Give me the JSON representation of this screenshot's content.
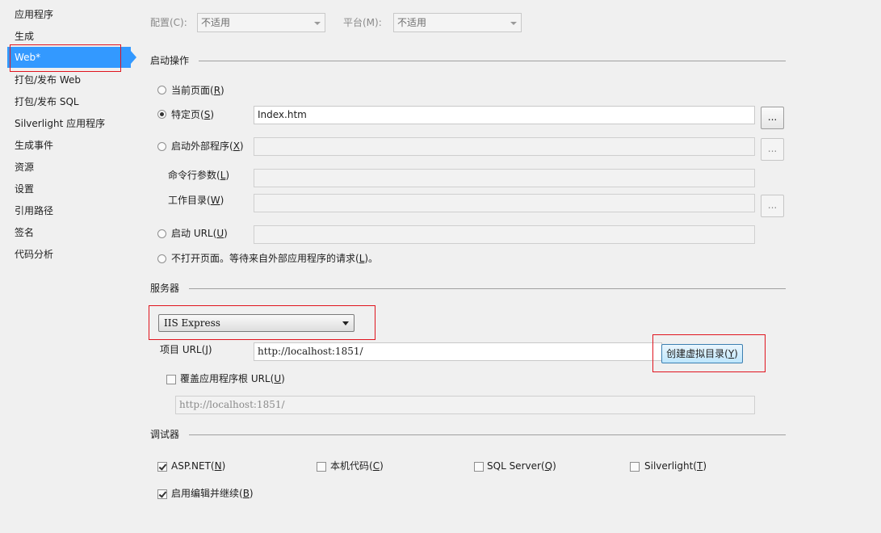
{
  "sidebar": {
    "items": [
      {
        "label": "应用程序"
      },
      {
        "label": "生成"
      },
      {
        "label": "Web*"
      },
      {
        "label": "打包/发布 Web"
      },
      {
        "label": "打包/发布 SQL"
      },
      {
        "label": "Silverlight 应用程序"
      },
      {
        "label": "生成事件"
      },
      {
        "label": "资源"
      },
      {
        "label": "设置"
      },
      {
        "label": "引用路径"
      },
      {
        "label": "签名"
      },
      {
        "label": "代码分析"
      }
    ],
    "active_color": "#3399ff"
  },
  "top": {
    "config_label": "配置(C):",
    "config_value": "不适用",
    "platform_label": "平台(M):",
    "platform_value": "不适用"
  },
  "start_action": {
    "title": "启动操作",
    "current_page": {
      "text": "当前页面(",
      "key": "R",
      "end": ")"
    },
    "specific_page": {
      "text": "特定页(",
      "key": "S",
      "end": ")",
      "value": "Index.htm"
    },
    "external_program": {
      "text": "启动外部程序(",
      "key": "X",
      "end": ")"
    },
    "cmd_args": {
      "text": "命令行参数(",
      "key": "L",
      "end": ")"
    },
    "work_dir": {
      "text": "工作目录(",
      "key": "W",
      "end": ")"
    },
    "start_url": {
      "text": "启动 URL(",
      "key": "U",
      "end": ")"
    },
    "no_open": {
      "text": "不打开页面。等待来自外部应用程序的请求(",
      "key": "L",
      "end": ")。"
    },
    "browse_label": "..."
  },
  "server": {
    "title": "服务器",
    "type_value": "IIS Express",
    "project_url": {
      "text": "项目 URL(",
      "key": "J",
      "end": ")",
      "value": "http://localhost:1851/"
    },
    "create_vdir": {
      "text": "创建虚拟目录(",
      "key": "Y",
      "end": ")"
    },
    "override_root": {
      "text": "覆盖应用程序根 URL(",
      "key": "U",
      "end": ")",
      "value": "http://localhost:1851/"
    }
  },
  "debuggers": {
    "title": "调试器",
    "aspnet": {
      "text": "ASP.NET(",
      "key": "N",
      "end": ")",
      "checked": true
    },
    "native": {
      "text": "本机代码(",
      "key": "C",
      "end": ")",
      "checked": false
    },
    "sql": {
      "text": "SQL Server(",
      "key": "Q",
      "end": ")",
      "checked": false
    },
    "silverlight": {
      "text": "Silverlight(",
      "key": "T",
      "end": ")",
      "checked": false
    },
    "edit_continue": {
      "text": "启用编辑并继续(",
      "key": "B",
      "end": ")",
      "checked": true
    }
  },
  "colors": {
    "highlight_border": "#e0141e"
  }
}
